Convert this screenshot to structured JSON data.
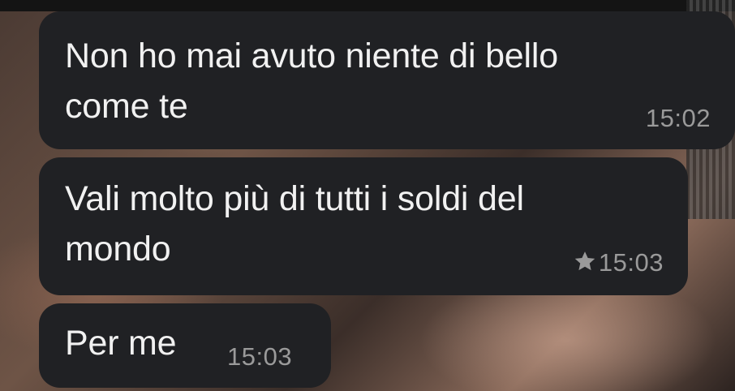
{
  "messages": [
    {
      "text_line1": "Non ho mai avuto niente di bello",
      "text_line2": "come te",
      "time": "15:02",
      "starred": false
    },
    {
      "text_line1": "Vali molto più di tutti i soldi del",
      "text_line2": "mondo",
      "time": "15:03",
      "starred": true
    },
    {
      "text_line1": "Per me",
      "time": "15:03",
      "starred": false
    }
  ],
  "colors": {
    "bubble_bg": "#202124",
    "text": "#f1f1f1",
    "timestamp": "#9a9a9a"
  },
  "icons": {
    "starred": "star-icon"
  }
}
